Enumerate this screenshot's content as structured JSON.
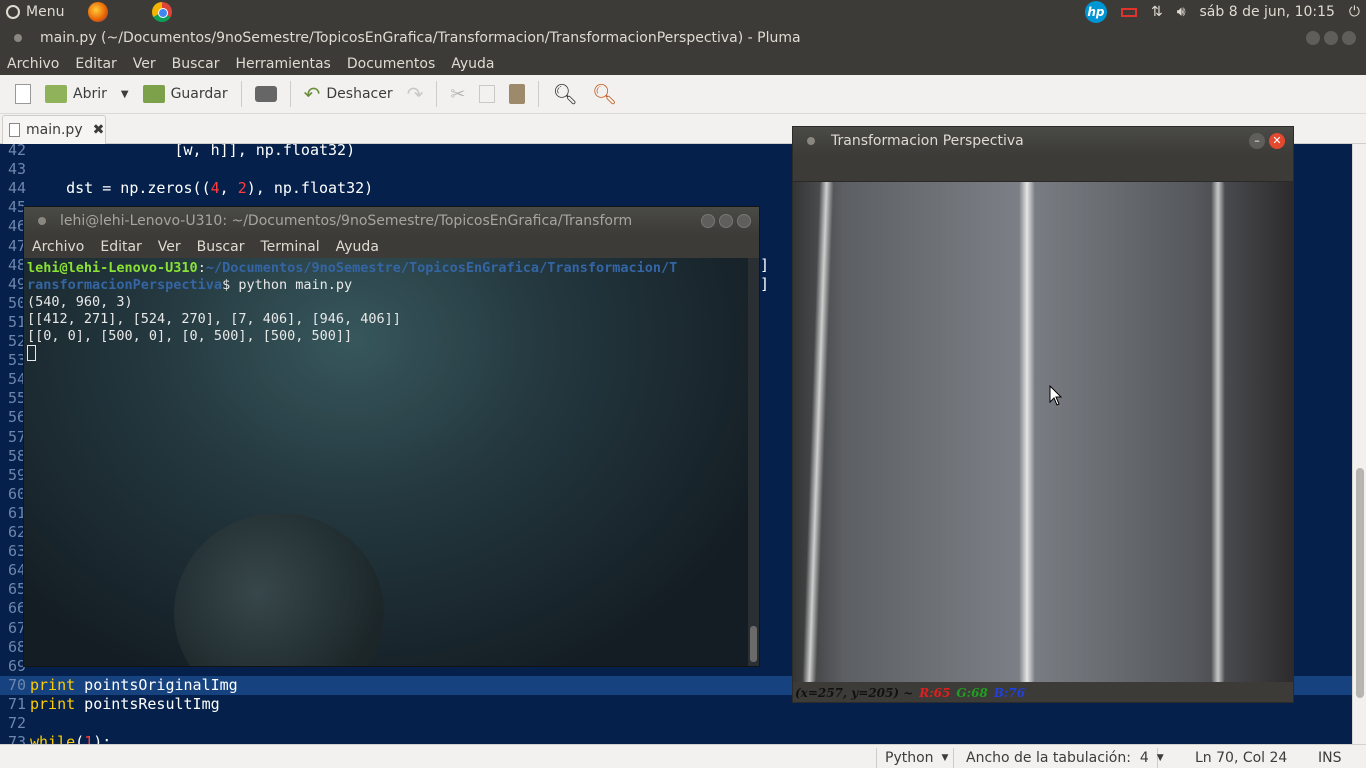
{
  "topbar": {
    "menu_label": "Menu",
    "clock": "sáb 8 de jun, 10:15",
    "apps": [
      "firefox-icon",
      "chrome-icon"
    ],
    "tray_icons": [
      "hp-icon",
      "battery-icon",
      "network-icon",
      "volume-icon",
      "power-icon"
    ]
  },
  "window": {
    "title": "main.py (~/Documentos/9noSemestre/TopicosEnGrafica/Transformacion/TransformacionPerspectiva) - Pluma"
  },
  "menu": [
    "Archivo",
    "Editar",
    "Ver",
    "Buscar",
    "Herramientas",
    "Documentos",
    "Ayuda"
  ],
  "toolbar": {
    "open_label": "Abrir",
    "save_label": "Guardar",
    "undo_label": "Deshacer"
  },
  "tab": {
    "label": "main.py"
  },
  "code_lines": [
    {
      "n": "42",
      "pre": "                [w, h]], np.float32)",
      "parts": []
    },
    {
      "n": "43",
      "pre": "",
      "parts": []
    },
    {
      "n": "44",
      "pre": "    dst = np.zeros((",
      "num1": "4",
      "mid": ", ",
      "num2": "2",
      "post": "), np.float32)"
    },
    {
      "n": "45"
    },
    {
      "n": "46"
    },
    {
      "n": "47"
    },
    {
      "n": "48"
    },
    {
      "n": "49"
    },
    {
      "n": "50"
    },
    {
      "n": "51"
    },
    {
      "n": "52"
    },
    {
      "n": "53"
    },
    {
      "n": "54"
    },
    {
      "n": "55"
    },
    {
      "n": "56"
    },
    {
      "n": "57"
    },
    {
      "n": "58"
    },
    {
      "n": "59"
    },
    {
      "n": "60"
    },
    {
      "n": "61"
    },
    {
      "n": "62"
    },
    {
      "n": "63"
    },
    {
      "n": "64"
    },
    {
      "n": "65"
    },
    {
      "n": "66"
    },
    {
      "n": "67"
    },
    {
      "n": "68"
    },
    {
      "n": "69"
    },
    {
      "n": "70",
      "kw": "print",
      "rest": " pointsOriginalImg"
    },
    {
      "n": "71",
      "kw": "print",
      "rest": " pointsResultImg"
    },
    {
      "n": "72"
    },
    {
      "n": "73",
      "kw": "while",
      "rest": "(",
      "num": "1",
      "end": "):"
    }
  ],
  "code_bracket_48": "]",
  "code_bracket_49": "]",
  "status": {
    "language": "Python",
    "tab_width": "Ancho de la tabulación:  4",
    "position": "Ln 70, Col 24",
    "mode": "INS"
  },
  "terminal": {
    "title": "lehi@lehi-Lenovo-U310: ~/Documentos/9noSemestre/TopicosEnGrafica/Transform",
    "menu": [
      "Archivo",
      "Editar",
      "Ver",
      "Buscar",
      "Terminal",
      "Ayuda"
    ],
    "prompt_user": "lehi@lehi-Lenovo-U310",
    "prompt_sep": ":",
    "prompt_path_1": "~/Documentos/9noSemestre/TopicosEnGrafica/Transformacion/T",
    "prompt_path_2": "ransformacionPerspectiva",
    "command": "$ python main.py",
    "output": [
      "(540, 960, 3)",
      "[[412, 271], [524, 270], [7, 406], [946, 406]]",
      "[[0, 0], [500, 0], [0, 500], [500, 500]]"
    ]
  },
  "cvwindow": {
    "title": "Transformacion Perspectiva",
    "coords": "(x=257, y=205) ~",
    "r": "R:65",
    "g": "G:68",
    "b": "B:76",
    "colors": {
      "r": "#e02020",
      "g": "#20a020",
      "b": "#2040e0"
    }
  }
}
